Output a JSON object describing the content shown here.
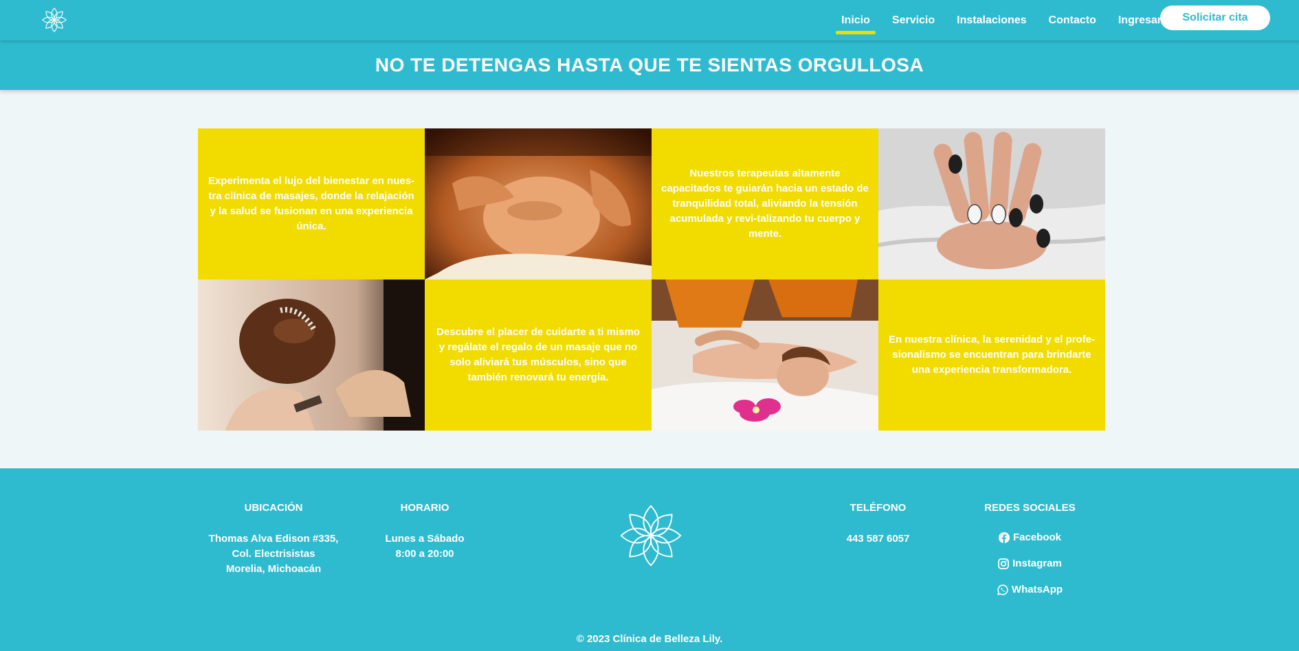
{
  "nav": {
    "logo_icon": "lotus-icon",
    "links": [
      "Inicio",
      "Servicio",
      "Instalaciones",
      "Contacto",
      "Ingresar"
    ],
    "active_index": 0,
    "cta_label": "Solicitar cita"
  },
  "banner": {
    "title": "NO TE DETENGAS HASTA QUE TE SIENTAS ORGULLOSA"
  },
  "grid": {
    "texts": [
      "Experimenta el lujo del bienestar en nues-tra clínica de masajes, donde la relajación y la salud se fusionan en una experiencia única.",
      "Nuestros terapeutas altamente capacitados te guiarán hacia un estado de tranquilidad total, aliviando la tensión acumulada y revi-talizando tu cuerpo y mente.",
      "Descubre el placer de cuidarte a ti mismo y regálate el regalo de un masaje que no solo aliviará tus músculos, sino que también renovará tu energía.",
      "En nuestra clínica, la serenidad y el profe-sionalismo se encuentran para brindarte una experiencia transformadora."
    ],
    "images": [
      "facial-massage-photo",
      "manicure-nails-photo",
      "bridal-hairstyle-photo",
      "back-massage-photo"
    ]
  },
  "footer": {
    "ubicacion": {
      "heading": "UBICACIÓN",
      "lines": [
        "Thomas Alva Edison #335,",
        "Col. Electrisistas",
        "Morelia, Michoacán"
      ]
    },
    "horario": {
      "heading": "HORARIO",
      "lines": [
        "Lunes a Sábado",
        "8:00 a 20:00"
      ]
    },
    "telefono": {
      "heading": "TELÉFONO",
      "number": "443 587 6057"
    },
    "redes": {
      "heading": "REDES SOCIALES",
      "links": [
        "Facebook",
        "Instagram",
        "WhatsApp"
      ]
    },
    "copyright": "© 2023 Clínica de Belleza Lily."
  },
  "colors": {
    "primary": "#2fbbcf",
    "accent": "#f2dc00",
    "background": "#eef6f7"
  }
}
